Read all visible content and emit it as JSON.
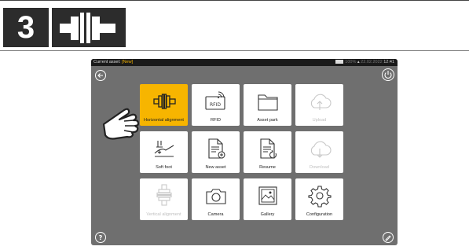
{
  "step": {
    "number": "3",
    "icon": "coupling-icon"
  },
  "tablet": {
    "status": {
      "asset_label": "Current asset:",
      "asset_value": "[New]",
      "battery_percent": "100%",
      "date": "22.02.2022",
      "time": "12:41"
    },
    "tiles": [
      {
        "id": "horizontal",
        "label": "Horizontal alignment",
        "icon": "coupling-icon",
        "active": true,
        "disabled": false
      },
      {
        "id": "rfid",
        "label": "RFID",
        "icon": "rfid-icon",
        "active": false,
        "disabled": false
      },
      {
        "id": "asset-park",
        "label": "Asset park",
        "icon": "folder-icon",
        "active": false,
        "disabled": false
      },
      {
        "id": "upload",
        "label": "Upload",
        "icon": "cloud-upload-icon",
        "active": false,
        "disabled": true
      },
      {
        "id": "soft-foot",
        "label": "Soft foot",
        "icon": "soft-foot-icon",
        "active": false,
        "disabled": false
      },
      {
        "id": "new-asset",
        "label": "New asset",
        "icon": "new-document-icon",
        "active": false,
        "disabled": false
      },
      {
        "id": "resume",
        "label": "Resume",
        "icon": "resume-document-icon",
        "active": false,
        "disabled": false
      },
      {
        "id": "download",
        "label": "Download",
        "icon": "cloud-download-icon",
        "active": false,
        "disabled": true
      },
      {
        "id": "vertical",
        "label": "Vertical alignment",
        "icon": "vertical-coupling-icon",
        "active": false,
        "disabled": true
      },
      {
        "id": "camera",
        "label": "Camera",
        "icon": "camera-icon",
        "active": false,
        "disabled": false
      },
      {
        "id": "gallery",
        "label": "Gallery",
        "icon": "gallery-icon",
        "active": false,
        "disabled": false
      },
      {
        "id": "configuration",
        "label": "Configuration",
        "icon": "gear-icon",
        "active": false,
        "disabled": false
      }
    ],
    "colors": {
      "accent": "#f7b500",
      "screen": "#6f6f6f",
      "statusbar": "#1a1a1a"
    }
  }
}
